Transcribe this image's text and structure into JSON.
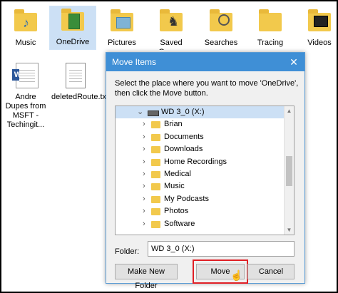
{
  "desktop": {
    "icons": [
      {
        "label": "Music"
      },
      {
        "label": "OneDrive"
      },
      {
        "label": "Pictures"
      },
      {
        "label": "Saved Games"
      },
      {
        "label": "Searches"
      },
      {
        "label": "Tracing"
      },
      {
        "label": "Videos"
      },
      {
        "label": "Andre Dupes from MSFT - Techingit..."
      },
      {
        "label": "deletedRoute.txt"
      }
    ]
  },
  "dialog": {
    "title": "Move Items",
    "close_glyph": "✕",
    "instruction": "Select the place where you want to move 'OneDrive', then click the Move button.",
    "tree": {
      "drive": "WD 3_0 (X:)",
      "folders": [
        "Brian",
        "Documents",
        "Downloads",
        "Home Recordings",
        "Medical",
        "Music",
        "My Podcasts",
        "Photos",
        "Software"
      ]
    },
    "folder_label": "Folder:",
    "folder_value": "WD 3_0 (X:)",
    "buttons": {
      "new_folder": "Make New Folder",
      "move": "Move",
      "cancel": "Cancel"
    }
  },
  "colors": {
    "title_bar": "#3f8fd6",
    "highlight": "#e01f25",
    "folder": "#f2c94c",
    "selection": "#cce0f5"
  }
}
